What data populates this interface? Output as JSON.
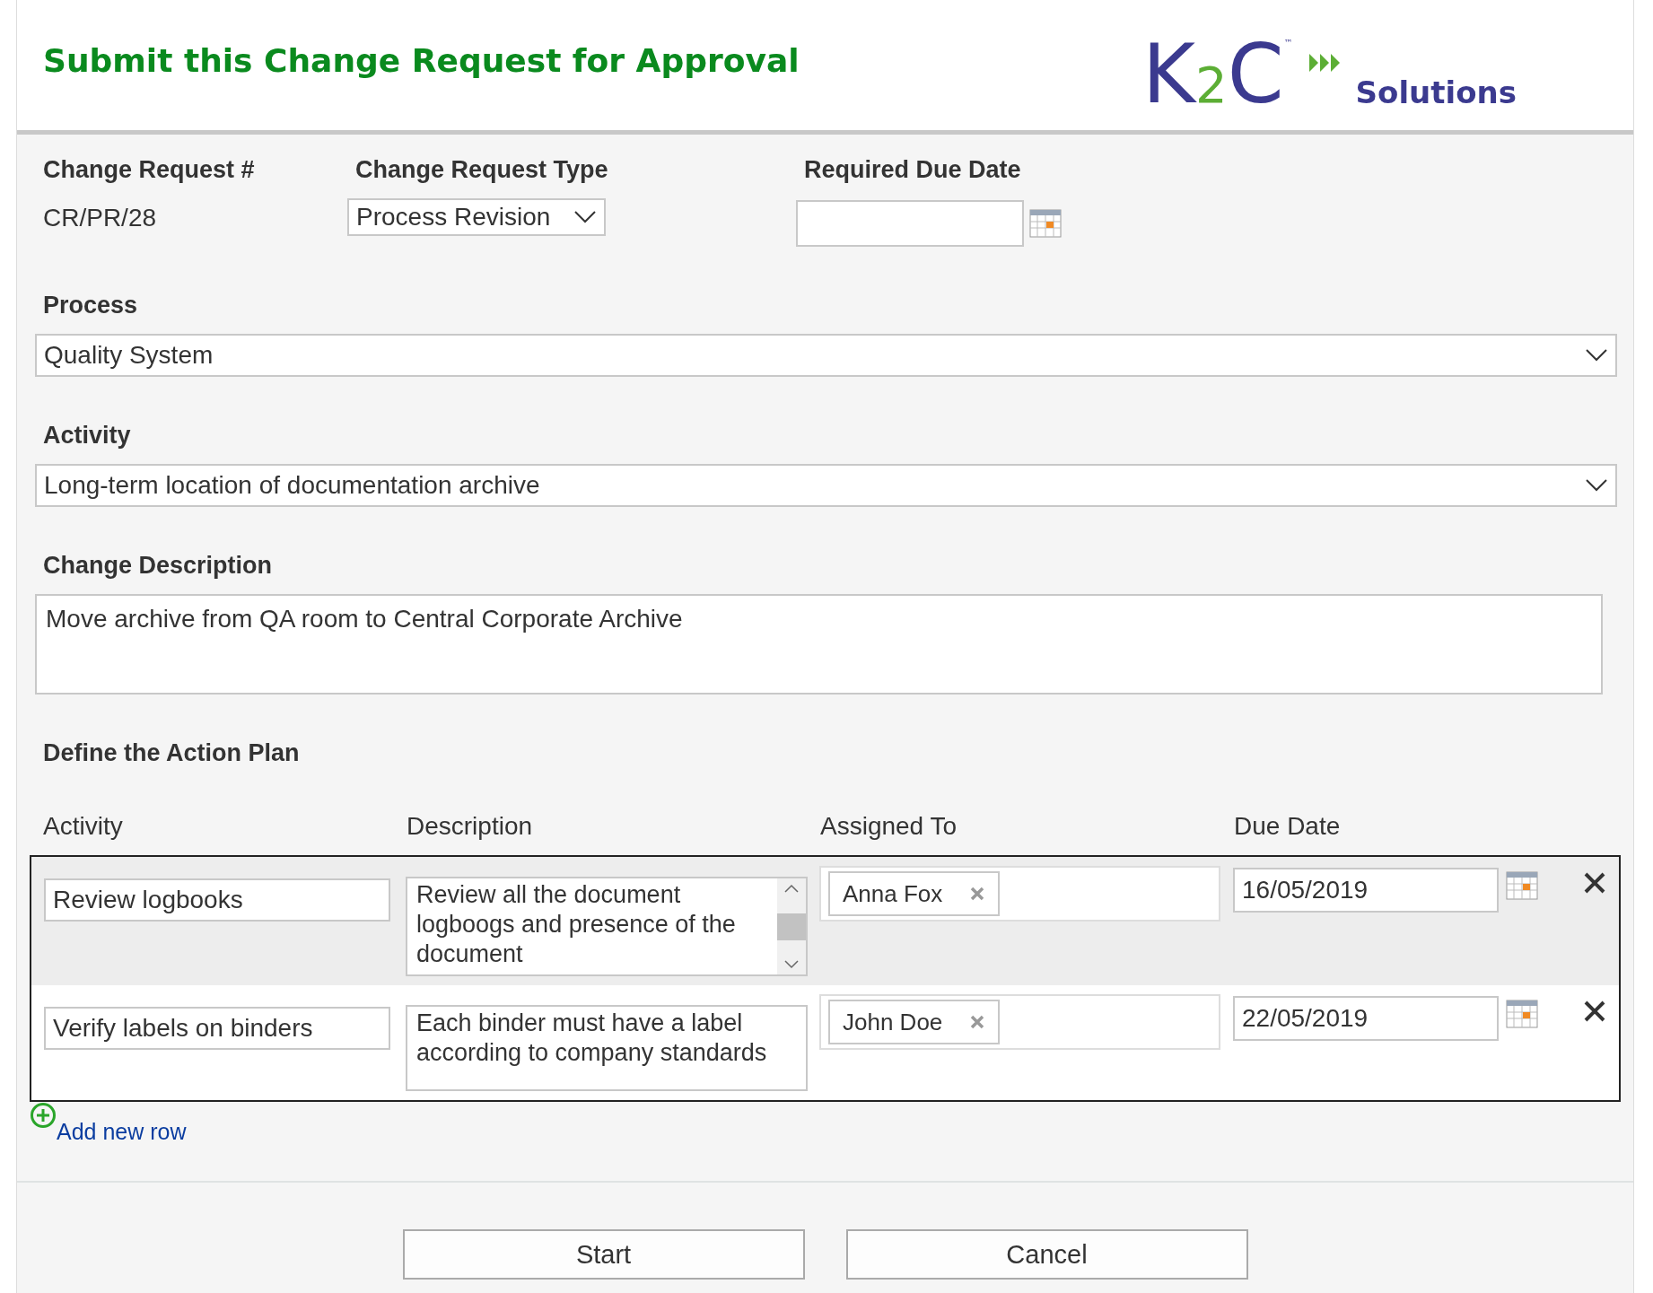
{
  "header": {
    "title": "Submit this Change Request for Approval",
    "logo": {
      "letters": [
        "K",
        "2",
        "C"
      ],
      "trademark": "™",
      "tagline": "Solutions"
    }
  },
  "request": {
    "number": {
      "label": "Change Request #",
      "value": "CR/PR/28"
    },
    "type": {
      "label": "Change Request Type",
      "value": "Process Revision"
    },
    "due_date": {
      "label": "Required Due Date"
    }
  },
  "process": {
    "label": "Process",
    "value": "Quality System"
  },
  "activity": {
    "label": "Activity",
    "value": "Long-term location of documentation archive"
  },
  "change_description": {
    "label": "Change Description",
    "value": "Move archive from QA room to Central Corporate Archive"
  },
  "action_plan": {
    "title": "Define the Action Plan",
    "columns": [
      "Activity",
      "Description",
      "Assigned To",
      "Due Date"
    ],
    "rows": [
      {
        "activity": "Review logbooks",
        "description": "Review all the document logboogs and presence of the document",
        "scrollable": true,
        "assignee": "Anna Fox",
        "due_date": "16/05/2019",
        "selected": true
      },
      {
        "activity": "Verify labels on binders",
        "description": "Each binder must have a label according to company standards",
        "scrollable": false,
        "assignee": "John Doe",
        "due_date": "22/05/2019",
        "selected": false
      }
    ],
    "add_row": "Add new row"
  },
  "buttons": [
    "Start",
    "Cancel"
  ]
}
